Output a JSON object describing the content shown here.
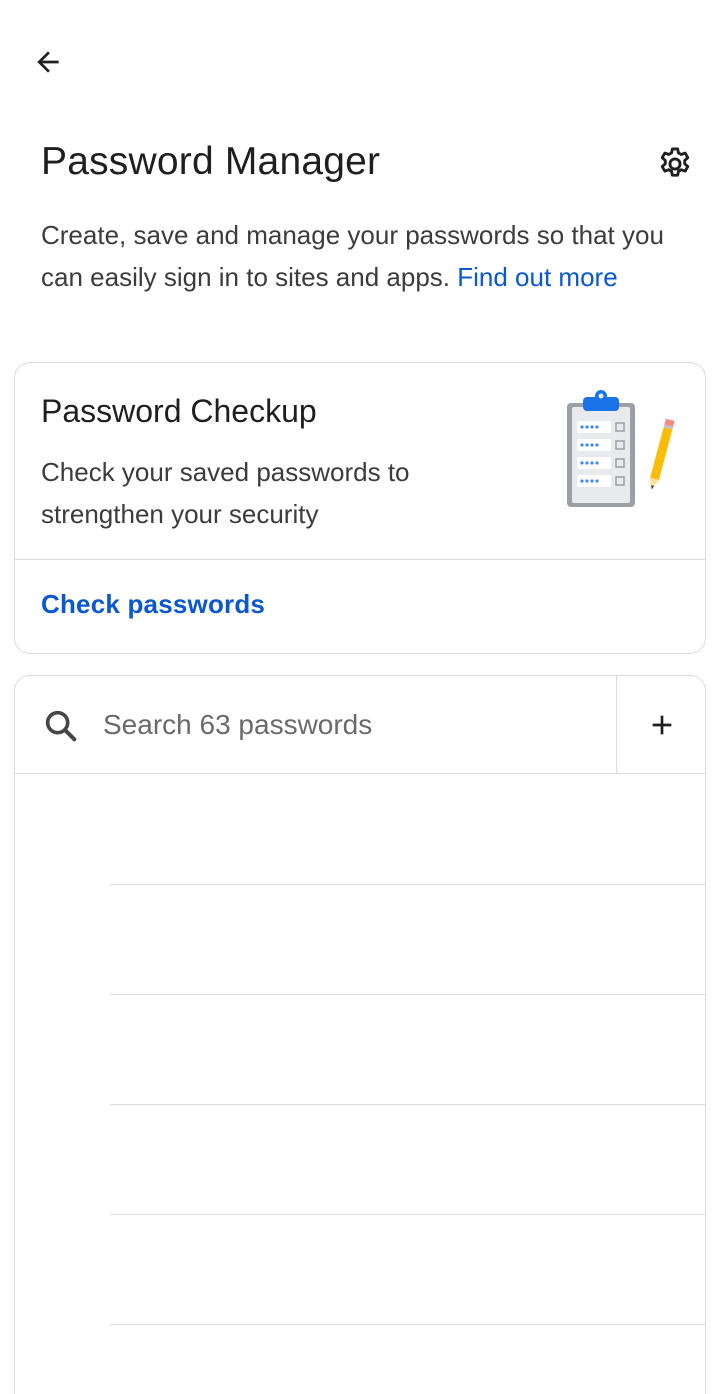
{
  "header": {
    "back_icon": "arrow-back-icon",
    "title": "Password Manager",
    "settings_icon": "gear-icon"
  },
  "intro": {
    "text": "Create, save and manage your passwords so that you can easily sign in to sites and apps. ",
    "link_text": "Find out more"
  },
  "checkup": {
    "title": "Password Checkup",
    "description": "Check your saved passwords to strengthen your security",
    "action_label": "Check passwords",
    "illustration": "clipboard-pencil-illustration"
  },
  "passwords": {
    "search_placeholder": "Search 63 passwords",
    "search_value": "",
    "search_icon": "search-icon",
    "add_icon": "plus-icon",
    "items": [
      {},
      {},
      {},
      {},
      {}
    ]
  },
  "colors": {
    "link": "#0b57d0",
    "text_primary": "#1f1f1f",
    "text_secondary": "#3c3c3c",
    "border": "#dadce0",
    "clipboard_blue": "#4285f4",
    "pencil_yellow": "#fbbc04"
  }
}
